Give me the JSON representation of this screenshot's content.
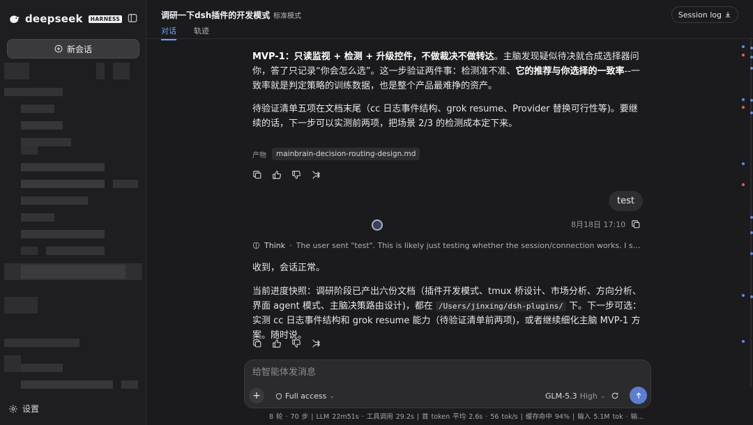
{
  "app": {
    "brand": "deepseek",
    "badge": "HARNESS"
  },
  "sidebar": {
    "new_chat_label": "新会话",
    "settings_label": "设置"
  },
  "header": {
    "title": "调研一下dsh插件的开发模式",
    "mode_label": "标准模式",
    "tabs": [
      {
        "label": "对话",
        "active": true
      },
      {
        "label": "轨迹",
        "active": false
      }
    ],
    "session_log_label": "Session log"
  },
  "messages": {
    "assistant1": {
      "para1_prefix": "MVP-1：",
      "para1_bold": "只读监视 + 检测 + 升级控件，不做裁决不做转达",
      "para1_mid": "。主脑发现疑似待决就合成选择器问你，答了只记录“你会怎么选”。这一步验证两件事：检测准不准、",
      "para1_bold2": "它的推荐与你选择的一致率",
      "para1_end": "--一致率就是判定策略的训练数据，也是整个产品最难挣的资产。",
      "para2": "待验证清单五项在文档末尾（cc 日志事件结构、grok resume、Provider 替换可行性等)。要继续的话，下一步可以实测前两项，把场景 2/3 的检测成本定下来。",
      "artifact_label": "产物",
      "artifact_file": "mainbrain-decision-routing-design.md"
    },
    "user": {
      "text": "test",
      "timestamp": "8月18日 17:10"
    },
    "assistant2": {
      "think_label": "Think",
      "think_text": "The user sent \"test\". This is likely just testing whether the session/connection works. I should respond briefly in Chinese, confirming things are working, and give a quick snapshot of where we are.",
      "reply1": "收到，会话正常。",
      "reply2_prefix": "当前进度快照：调研阶段已产出六份文档（插件开发模式、tmux 桥设计、市场分析、方向分析、界面 agent 模式、主脑决策路由设计)，都在 ",
      "reply2_path": "/Users/jinxing/dsh-plugins/",
      "reply2_suffix": " 下。下一步可选：实测 cc 日志事件结构和 grok resume 能力（待验证清单前两项)，或者继续细化主脑 MVP-1 方案。随时说。"
    }
  },
  "composer": {
    "placeholder": "给智能体发消息",
    "access_label": "Full access",
    "model_name": "GLM-5.3",
    "model_level": "High"
  },
  "status": {
    "text": "8 轮 · 70 步   |   LLM 22m51s · 工具调用 29.2s   |   首 token 平均 2.6s · 56 tok/s   |   缓存命中 94%   |   输入 5.1M tok · 输..."
  },
  "icons": {
    "logo": "whale-logo-icon",
    "sidebar_toggle": "sidebar-toggle-icon",
    "new_chat": "plus-circle-icon",
    "settings": "gear-icon",
    "mode": "rocket-icon",
    "download": "download-icon",
    "copy": "copy-icon",
    "thumbs_up": "thumbs-up-icon",
    "thumbs_down": "thumbs-down-icon",
    "branch": "branch-icon",
    "think": "brain-icon",
    "lock": "shield-icon",
    "refresh": "refresh-icon",
    "send": "arrow-up-icon"
  },
  "colors": {
    "accent": "#6aa5ff",
    "send": "#5b7fd0",
    "marker_blue": "#5b8def",
    "marker_red": "#e5604d"
  }
}
